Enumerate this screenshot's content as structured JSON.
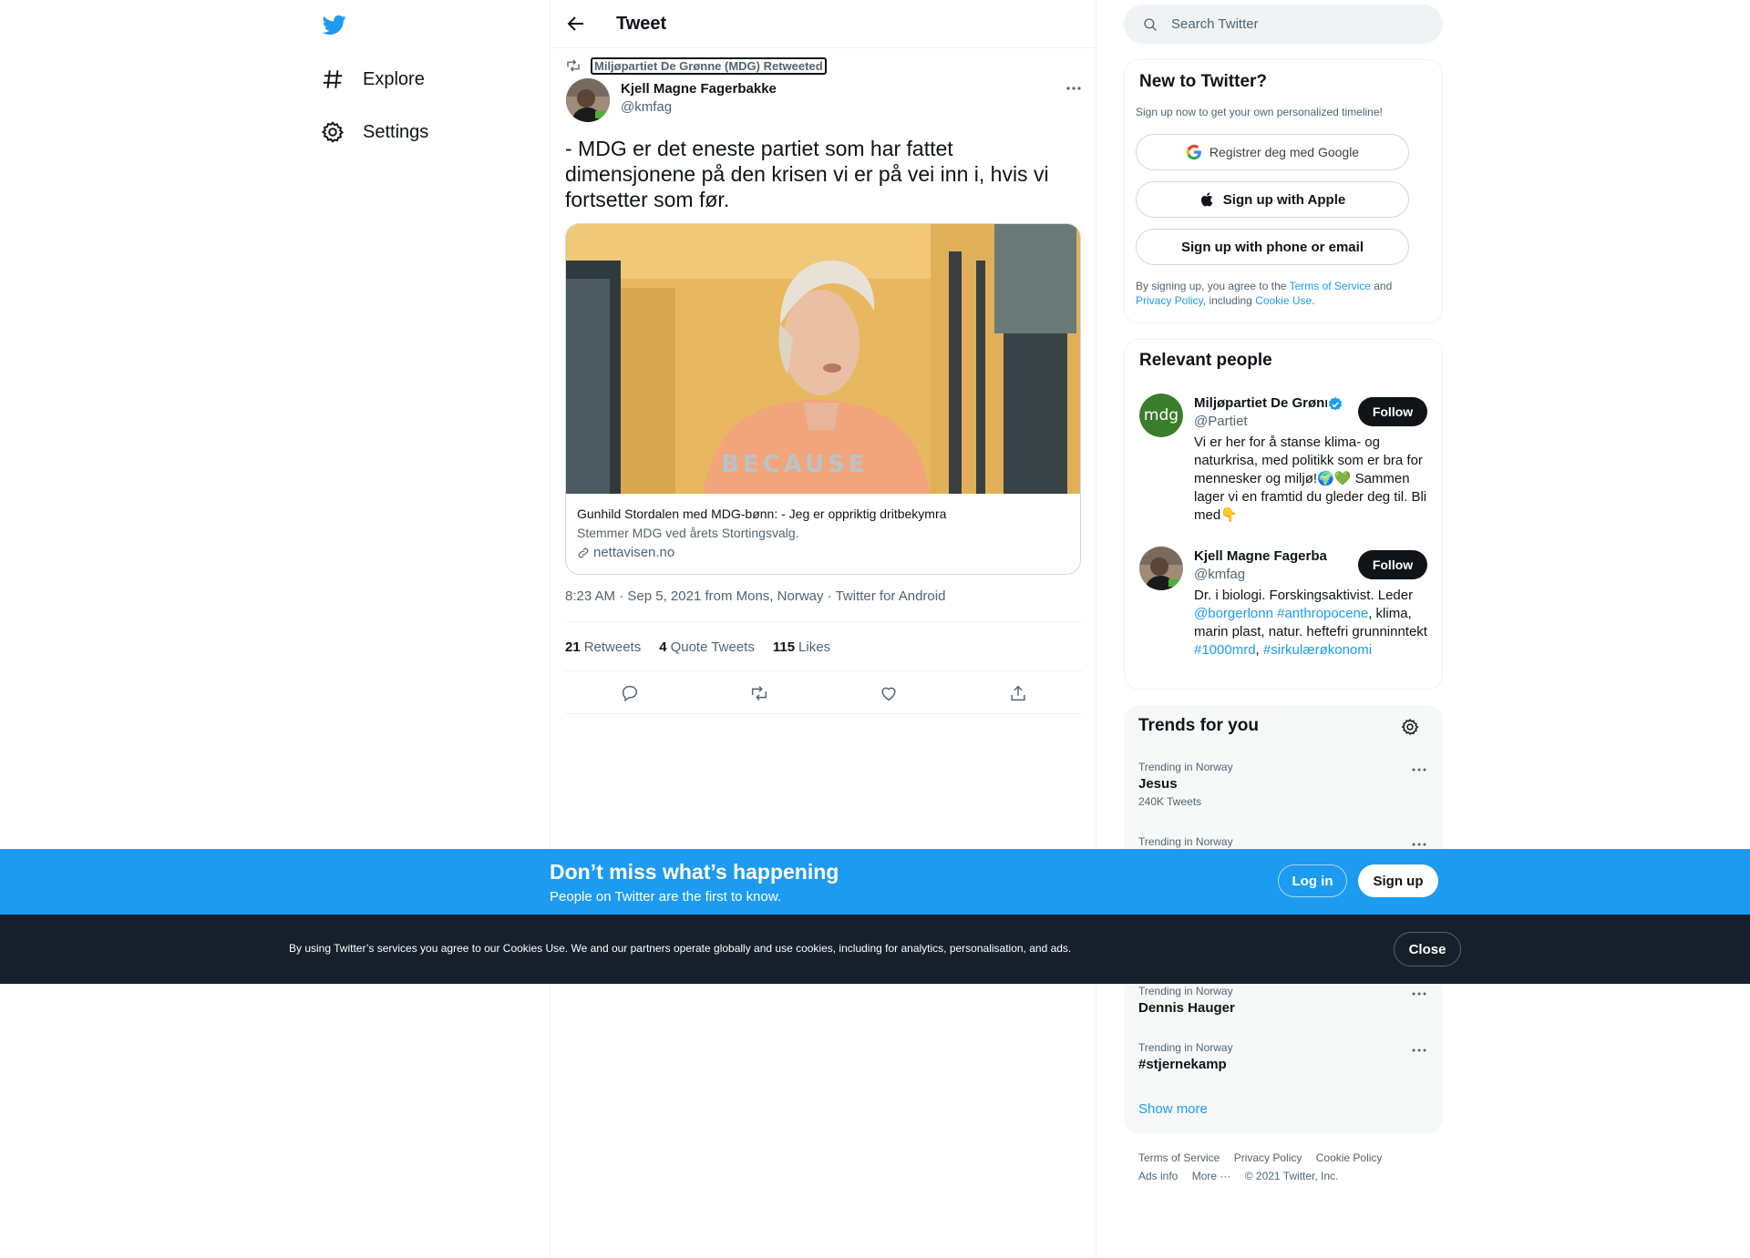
{
  "nav": {
    "logo": "twitter-bird-icon",
    "items": [
      {
        "label": "Explore",
        "icon": "hashtag-icon"
      },
      {
        "label": "Settings",
        "icon": "gear-icon"
      }
    ]
  },
  "header": {
    "title": "Tweet"
  },
  "tweet": {
    "retweeted_by": "Miljøpartiet De Grønne (MDG) Retweeted",
    "author_name": "Kjell Magne Fagerbakke",
    "author_handle": "@kmfag",
    "text": "- MDG er det eneste partiet som har fattet dimensjonene på den krisen vi er på vei inn i, hvis vi fortsetter som før.",
    "card": {
      "title": "Gunhild Stordalen med MDG-bønn: - Jeg er oppriktig dritbekymra",
      "description": "Stemmer MDG ved årets Stortingsvalg.",
      "domain": "nettavisen.no"
    },
    "meta": {
      "time": "8:23 AM",
      "sep1": " · ",
      "date": "Sep 5, 2021",
      "location": " from Mons, Norway",
      "sep2": " · ",
      "client": "Twitter for Android"
    },
    "stats": {
      "retweets_count": "21",
      "retweets_label": "Retweets",
      "quotes_count": "4",
      "quotes_label": "Quote Tweets",
      "likes_count": "115",
      "likes_label": "Likes"
    }
  },
  "search": {
    "placeholder": "Search Twitter"
  },
  "new_to_twitter": {
    "title": "New to Twitter?",
    "subtitle": "Sign up now to get your own personalized timeline!",
    "google_label": "Registrer deg med Google",
    "apple_label": "Sign up with Apple",
    "email_label": "Sign up with phone or email",
    "terms_prefix": "By signing up, you agree to the ",
    "terms_link": "Terms of Service",
    "terms_and": " and ",
    "privacy_link": "Privacy Policy",
    "terms_including": ", including ",
    "cookie_link": "Cookie Use",
    "terms_end": "."
  },
  "relevant_people": {
    "title": "Relevant people",
    "people": [
      {
        "name": "Miljøpartiet De Grønne (MDG)",
        "handle": "@Partiet",
        "avatar_text": "mdg",
        "follow_label": "Follow",
        "bio": "Vi er her for å stanse klima- og naturkrisa, med politikk som er bra for mennesker og miljø!🌍💚 Sammen lager vi en framtid du gleder deg til. Bli med👇"
      },
      {
        "name": "Kjell Magne Fagerbakke",
        "handle": "@kmfag",
        "follow_label": "Follow",
        "bio_part1": "Dr. i biologi. Forskingsaktivist. Leder ",
        "bio_link1": "@borgerlonn",
        "bio_space": " ",
        "bio_link2": "#anthropocene",
        "bio_part2": ", klima, marin plast, natur. heftefri grunninntekt ",
        "bio_link3": "#1000mrd",
        "bio_part3": ", ",
        "bio_link4": "#sirkulærøkonomi"
      }
    ]
  },
  "trends": {
    "title": "Trends for you",
    "items": [
      {
        "context": "Trending in Norway",
        "name": "Jesus",
        "count": "240K Tweets"
      },
      {
        "context": "Trending in Norway",
        "name": ""
      },
      {
        "context": "Trending in Norway",
        "name": "Dennis Hauger"
      },
      {
        "context": "Trending in Norway",
        "name": "#stjernekamp"
      }
    ],
    "show_more": "Show more"
  },
  "footer": {
    "links": [
      "Terms of Service",
      "Privacy Policy",
      "Cookie Policy",
      "Ads info",
      "More ···"
    ],
    "copyright": "© 2021 Twitter, Inc."
  },
  "signup_bar": {
    "title": "Don’t miss what’s happening",
    "subtitle": "People on Twitter are the first to know.",
    "login_label": "Log in",
    "signup_label": "Sign up"
  },
  "cookie_bar": {
    "text": "By using Twitter’s services you agree to our Cookies Use. We and our partners operate globally and use cookies, including for analytics, personalisation, and ads.",
    "close_label": "Close"
  },
  "colors": {
    "accent": "#1d9bf0",
    "text": "#0f1419",
    "muted": "#536471",
    "cookie_bg": "#15202b",
    "mdg_green": "#3a7d2a"
  }
}
